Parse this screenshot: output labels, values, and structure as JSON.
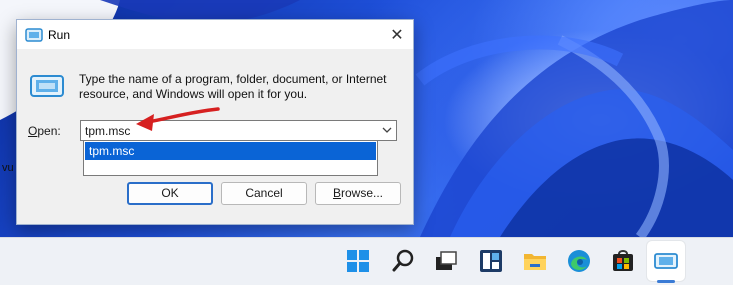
{
  "window": {
    "title": "Run",
    "close_label": "✕"
  },
  "dialog": {
    "description": "Type the name of a program, folder, document, or Internet resource, and Windows will open it for you.",
    "open_label_prefix": "",
    "open_label_accel": "O",
    "open_label_rest": "pen:",
    "input_value": "tpm.msc",
    "suggestion": "tpm.msc"
  },
  "buttons": {
    "ok": "OK",
    "cancel": "Cancel",
    "browse_accel": "B",
    "browse_rest": "rowse..."
  },
  "desktop": {
    "stray_text": "vu"
  },
  "taskbar": {
    "icons": [
      "start-icon",
      "search-icon",
      "task-view-icon",
      "widgets-icon",
      "file-explorer-icon",
      "edge-icon",
      "store-icon",
      "run-icon"
    ]
  },
  "colors": {
    "accent": "#0a64d6",
    "annotation_arrow": "#d62020"
  }
}
